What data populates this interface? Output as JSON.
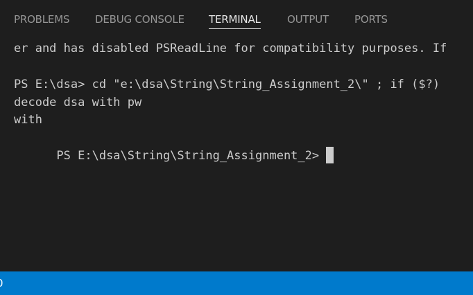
{
  "tabs": [
    {
      "label": "PROBLEMS"
    },
    {
      "label": "DEBUG CONSOLE"
    },
    {
      "label": "TERMINAL",
      "active": true
    },
    {
      "label": "OUTPUT"
    },
    {
      "label": "PORTS"
    }
  ],
  "terminal": {
    "lines": [
      "er and has disabled PSReadLine for compatibility purposes. If",
      "",
      "PS E:\\dsa> cd \"e:\\dsa\\String\\String_Assignment_2\\\" ; if ($?)",
      "decode dsa with pw",
      "with",
      "PS E:\\dsa\\String\\String_Assignment_2>"
    ]
  },
  "statusbar": {
    "text": "0"
  },
  "colors": {
    "background": "#1e1e1e",
    "tab_inactive": "#969696",
    "tab_active": "#e7e7e7",
    "terminal_text": "#cccccc",
    "statusbar": "#007acc"
  }
}
